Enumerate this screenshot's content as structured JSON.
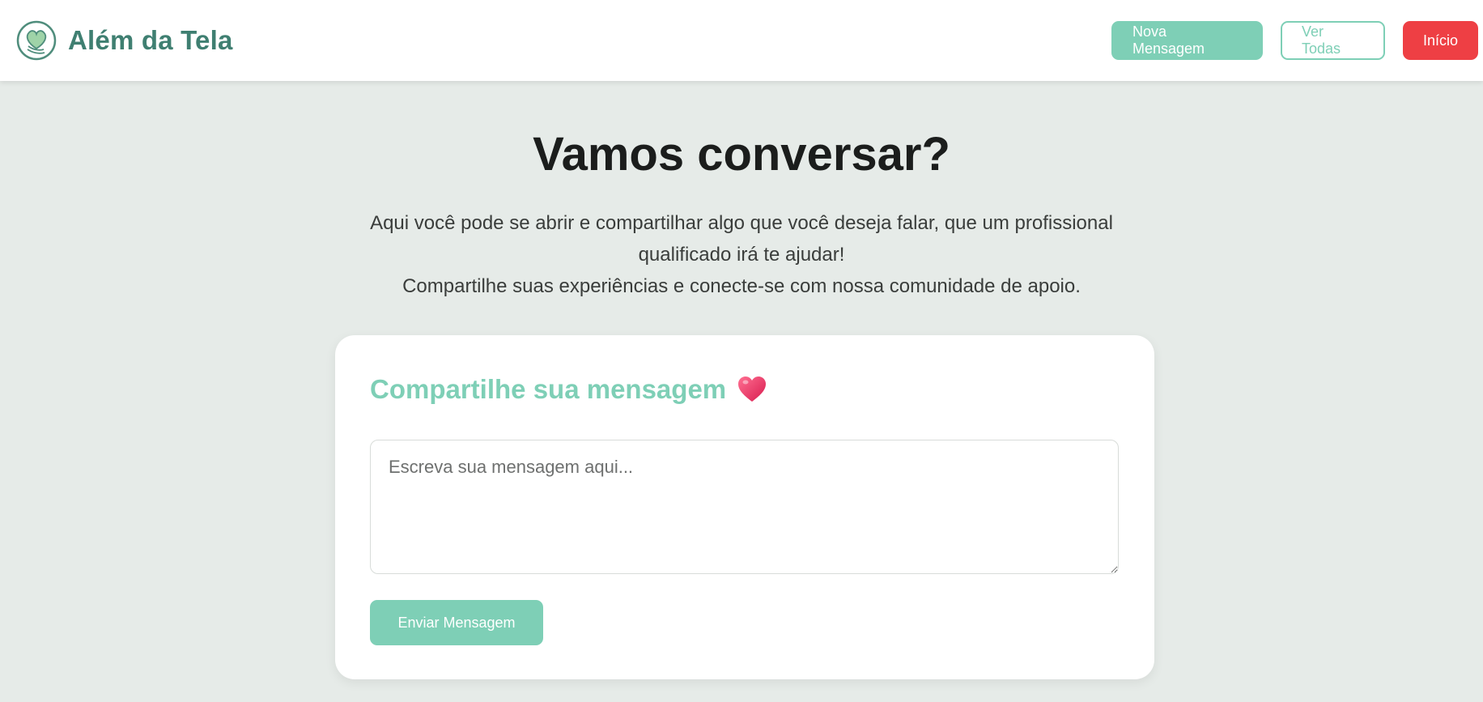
{
  "header": {
    "brand_name": "Além da Tela",
    "logo_icon": "heart-head-logo-icon",
    "nav": {
      "new_message": "Nova Mensagem",
      "view_all": "Ver Todas",
      "home": "Início"
    }
  },
  "hero": {
    "title": "Vamos conversar?",
    "line1": "Aqui você pode se abrir e compartilhar algo que você deseja falar, que um profissional qualificado irá te ajudar!",
    "line2": "Compartilhe suas experiências e conecte-se com nossa comunidade de apoio."
  },
  "form": {
    "title": "Compartilhe sua mensagem",
    "title_icon": "heart-icon",
    "placeholder": "Escreva sua mensagem aqui...",
    "value": "",
    "submit_label": "Enviar Mensagem"
  },
  "colors": {
    "brand": "#3f7f71",
    "accent": "#7ecfb6",
    "danger": "#ee3f44",
    "page_bg": "#e6ebe8"
  }
}
